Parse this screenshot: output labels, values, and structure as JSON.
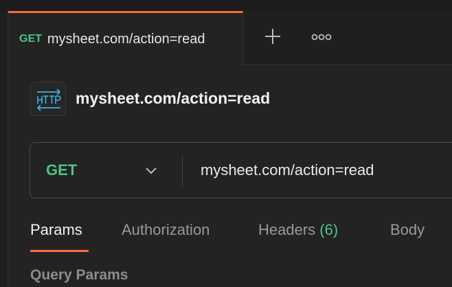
{
  "tabs": [
    {
      "method": "GET",
      "title": "mysheet.com/action=read",
      "active": true
    }
  ],
  "request": {
    "title": "mysheet.com/action=read",
    "icon": "http-icon",
    "method": "GET",
    "url": "mysheet.com/action=read"
  },
  "request_tabs": [
    {
      "label": "Params",
      "active": true
    },
    {
      "label": "Authorization"
    },
    {
      "label": "Headers",
      "count": "(6)"
    },
    {
      "label": "Body"
    }
  ],
  "section": {
    "label": "Query Params"
  },
  "colors": {
    "accent": "#ff6c37",
    "method_get": "#4fc386",
    "background": "#232323"
  }
}
